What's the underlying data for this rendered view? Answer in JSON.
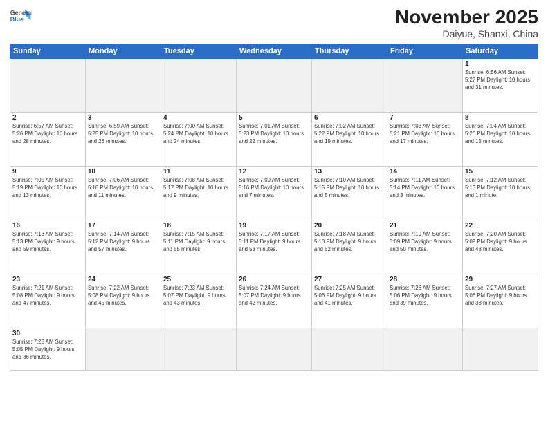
{
  "header": {
    "logo_general": "General",
    "logo_blue": "Blue",
    "month_title": "November 2025",
    "subtitle": "Daiyue, Shanxi, China"
  },
  "weekdays": [
    "Sunday",
    "Monday",
    "Tuesday",
    "Wednesday",
    "Thursday",
    "Friday",
    "Saturday"
  ],
  "weeks": [
    [
      {
        "day": "",
        "info": ""
      },
      {
        "day": "",
        "info": ""
      },
      {
        "day": "",
        "info": ""
      },
      {
        "day": "",
        "info": ""
      },
      {
        "day": "",
        "info": ""
      },
      {
        "day": "",
        "info": ""
      },
      {
        "day": "1",
        "info": "Sunrise: 6:56 AM\nSunset: 5:27 PM\nDaylight: 10 hours\nand 31 minutes."
      }
    ],
    [
      {
        "day": "2",
        "info": "Sunrise: 6:57 AM\nSunset: 5:26 PM\nDaylight: 10 hours\nand 28 minutes."
      },
      {
        "day": "3",
        "info": "Sunrise: 6:59 AM\nSunset: 5:25 PM\nDaylight: 10 hours\nand 26 minutes."
      },
      {
        "day": "4",
        "info": "Sunrise: 7:00 AM\nSunset: 5:24 PM\nDaylight: 10 hours\nand 24 minutes."
      },
      {
        "day": "5",
        "info": "Sunrise: 7:01 AM\nSunset: 5:23 PM\nDaylight: 10 hours\nand 22 minutes."
      },
      {
        "day": "6",
        "info": "Sunrise: 7:02 AM\nSunset: 5:22 PM\nDaylight: 10 hours\nand 19 minutes."
      },
      {
        "day": "7",
        "info": "Sunrise: 7:03 AM\nSunset: 5:21 PM\nDaylight: 10 hours\nand 17 minutes."
      },
      {
        "day": "8",
        "info": "Sunrise: 7:04 AM\nSunset: 5:20 PM\nDaylight: 10 hours\nand 15 minutes."
      }
    ],
    [
      {
        "day": "9",
        "info": "Sunrise: 7:05 AM\nSunset: 5:19 PM\nDaylight: 10 hours\nand 13 minutes."
      },
      {
        "day": "10",
        "info": "Sunrise: 7:06 AM\nSunset: 5:18 PM\nDaylight: 10 hours\nand 11 minutes."
      },
      {
        "day": "11",
        "info": "Sunrise: 7:08 AM\nSunset: 5:17 PM\nDaylight: 10 hours\nand 9 minutes."
      },
      {
        "day": "12",
        "info": "Sunrise: 7:09 AM\nSunset: 5:16 PM\nDaylight: 10 hours\nand 7 minutes."
      },
      {
        "day": "13",
        "info": "Sunrise: 7:10 AM\nSunset: 5:15 PM\nDaylight: 10 hours\nand 5 minutes."
      },
      {
        "day": "14",
        "info": "Sunrise: 7:11 AM\nSunset: 5:14 PM\nDaylight: 10 hours\nand 3 minutes."
      },
      {
        "day": "15",
        "info": "Sunrise: 7:12 AM\nSunset: 5:13 PM\nDaylight: 10 hours\nand 1 minute."
      }
    ],
    [
      {
        "day": "16",
        "info": "Sunrise: 7:13 AM\nSunset: 5:13 PM\nDaylight: 9 hours\nand 59 minutes."
      },
      {
        "day": "17",
        "info": "Sunrise: 7:14 AM\nSunset: 5:12 PM\nDaylight: 9 hours\nand 57 minutes."
      },
      {
        "day": "18",
        "info": "Sunrise: 7:15 AM\nSunset: 5:11 PM\nDaylight: 9 hours\nand 55 minutes."
      },
      {
        "day": "19",
        "info": "Sunrise: 7:17 AM\nSunset: 5:11 PM\nDaylight: 9 hours\nand 53 minutes."
      },
      {
        "day": "20",
        "info": "Sunrise: 7:18 AM\nSunset: 5:10 PM\nDaylight: 9 hours\nand 52 minutes."
      },
      {
        "day": "21",
        "info": "Sunrise: 7:19 AM\nSunset: 5:09 PM\nDaylight: 9 hours\nand 50 minutes."
      },
      {
        "day": "22",
        "info": "Sunrise: 7:20 AM\nSunset: 5:09 PM\nDaylight: 9 hours\nand 48 minutes."
      }
    ],
    [
      {
        "day": "23",
        "info": "Sunrise: 7:21 AM\nSunset: 5:08 PM\nDaylight: 9 hours\nand 47 minutes."
      },
      {
        "day": "24",
        "info": "Sunrise: 7:22 AM\nSunset: 5:08 PM\nDaylight: 9 hours\nand 45 minutes."
      },
      {
        "day": "25",
        "info": "Sunrise: 7:23 AM\nSunset: 5:07 PM\nDaylight: 9 hours\nand 43 minutes."
      },
      {
        "day": "26",
        "info": "Sunrise: 7:24 AM\nSunset: 5:07 PM\nDaylight: 9 hours\nand 42 minutes."
      },
      {
        "day": "27",
        "info": "Sunrise: 7:25 AM\nSunset: 5:06 PM\nDaylight: 9 hours\nand 41 minutes."
      },
      {
        "day": "28",
        "info": "Sunrise: 7:26 AM\nSunset: 5:06 PM\nDaylight: 9 hours\nand 39 minutes."
      },
      {
        "day": "29",
        "info": "Sunrise: 7:27 AM\nSunset: 5:06 PM\nDaylight: 9 hours\nand 38 minutes."
      }
    ],
    [
      {
        "day": "30",
        "info": "Sunrise: 7:28 AM\nSunset: 5:05 PM\nDaylight: 9 hours\nand 36 minutes."
      },
      {
        "day": "",
        "info": ""
      },
      {
        "day": "",
        "info": ""
      },
      {
        "day": "",
        "info": ""
      },
      {
        "day": "",
        "info": ""
      },
      {
        "day": "",
        "info": ""
      },
      {
        "day": "",
        "info": ""
      }
    ]
  ]
}
